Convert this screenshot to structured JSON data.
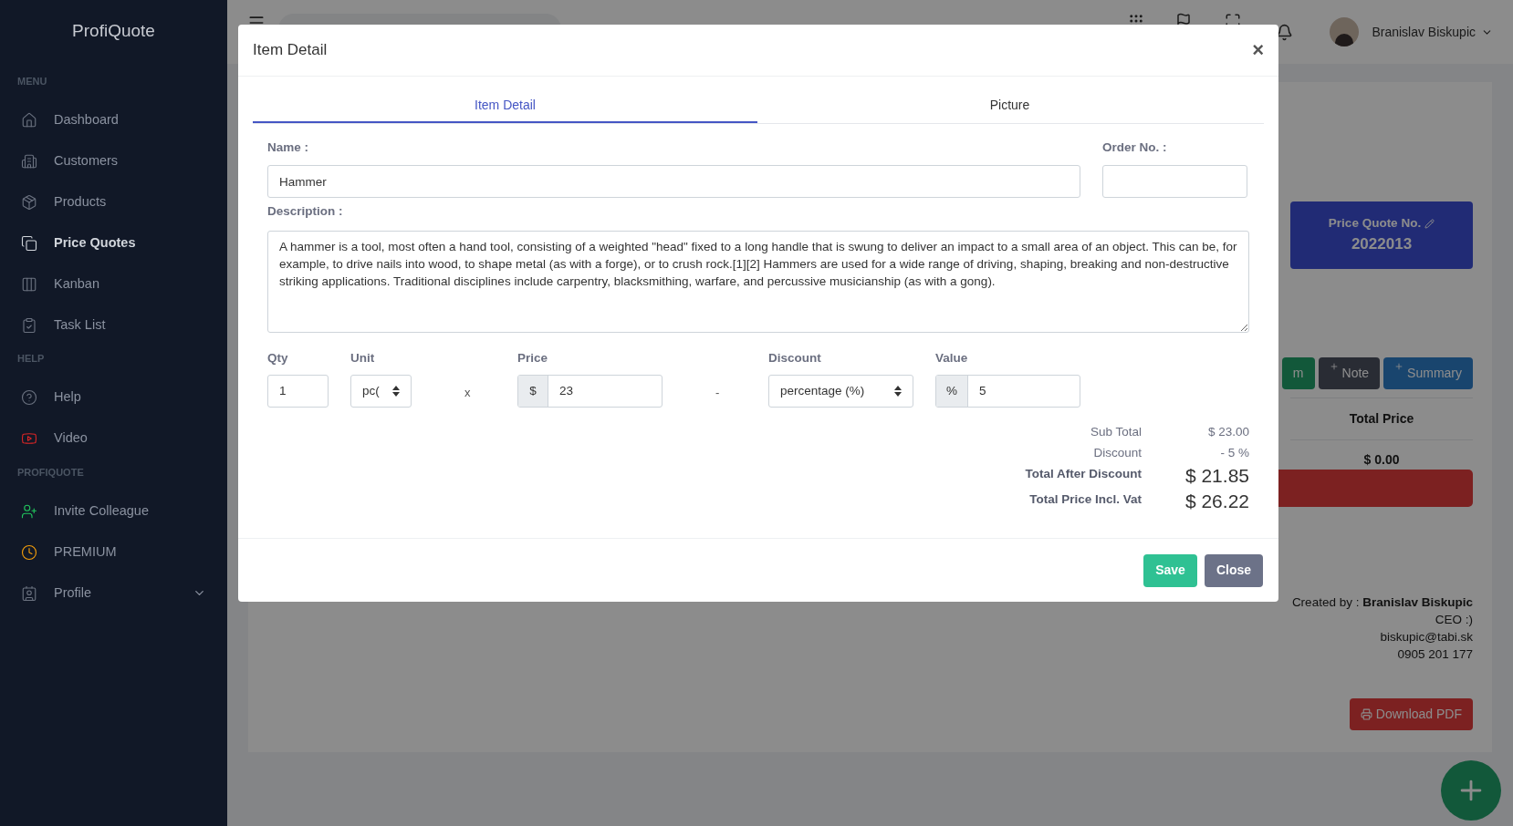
{
  "sidebar": {
    "brand": "ProfiQuote",
    "sections": [
      {
        "heading": "MENU",
        "items": [
          {
            "label": "Dashboard",
            "selected": false,
            "kind": "link"
          },
          {
            "label": "Customers",
            "selected": false,
            "kind": "link"
          },
          {
            "label": "Products",
            "selected": false,
            "kind": "link"
          },
          {
            "label": "Price Quotes",
            "selected": true,
            "kind": "link"
          },
          {
            "label": "Kanban",
            "selected": false,
            "kind": "link"
          },
          {
            "label": "Task List",
            "selected": false,
            "kind": "link"
          }
        ]
      },
      {
        "heading": "HELP",
        "items": [
          {
            "label": "Help",
            "selected": false,
            "kind": "link"
          },
          {
            "label": "Video",
            "selected": false,
            "kind": "link"
          }
        ]
      },
      {
        "heading": "PROFIQUOTE",
        "items": [
          {
            "label": "Invite Colleague",
            "selected": false,
            "kind": "link"
          },
          {
            "label": "PREMIUM",
            "selected": false,
            "kind": "link"
          },
          {
            "label": "Profile",
            "selected": false,
            "kind": "dropdown"
          }
        ]
      }
    ]
  },
  "topbar": {
    "user_name": "Branislav Biskupic"
  },
  "quote_panel": {
    "title": "Price Quote No.",
    "number": "2022013",
    "buttons": [
      {
        "label": "m",
        "kind": "success"
      },
      {
        "label": "Note",
        "kind": "secondary"
      },
      {
        "label": "Summary",
        "kind": "primary"
      }
    ],
    "table_header": "Total Price",
    "total": "$ 0.00",
    "created_by_label": "Created by :",
    "created_by_name": "Branislav Biskupic",
    "role": "CEO :)",
    "email": "biskupic@tabi.sk",
    "phone": "0905 201 177",
    "download_button": "Download PDF"
  },
  "modal": {
    "title": "Item Detail",
    "close": "×",
    "tabs": [
      {
        "label": "Item Detail",
        "selected": true
      },
      {
        "label": "Picture",
        "selected": false
      }
    ],
    "name": {
      "label": "Name :",
      "value": "Hammer"
    },
    "order_no": {
      "label": "Order No. :"
    },
    "description": {
      "label": "Description :",
      "value": "A hammer is a tool, most often a hand tool, consisting of a weighted \"head\" fixed to a long handle that is swung to deliver an impact to a small area of an object. This can be, for example, to drive nails into wood, to shape metal (as with a forge), or to crush rock.[1][2] Hammers are used for a wide range of driving, shaping, breaking and non-destructive striking applications. Traditional disciplines include carpentry, blacksmithing, warfare, and percussive musicianship (as with a gong)."
    },
    "qty": {
      "label": "Qty",
      "value": "1"
    },
    "unit": {
      "label": "Unit",
      "value": "pc("
    },
    "multiply_sign": "x",
    "price": {
      "label": "Price",
      "prefix": "$",
      "value": "23"
    },
    "minus_sign": "-",
    "discount": {
      "label": "Discount",
      "value": "percentage (%)"
    },
    "discount_value": {
      "label": "Value",
      "prefix": "%",
      "value": "5"
    },
    "summary": [
      {
        "label": "Sub Total",
        "value": "$ 23.00",
        "kind": "normal"
      },
      {
        "label": "Discount",
        "value": "- 5 %",
        "kind": "normal"
      },
      {
        "label": "Total After Discount",
        "value": "$ 21.85",
        "kind": "total"
      },
      {
        "label": "Total Price Incl. Vat",
        "value": "$ 26.22",
        "kind": "total"
      }
    ],
    "buttons": [
      {
        "label": "Save",
        "kind": "primary"
      },
      {
        "label": "Close",
        "kind": "secondary"
      }
    ]
  }
}
